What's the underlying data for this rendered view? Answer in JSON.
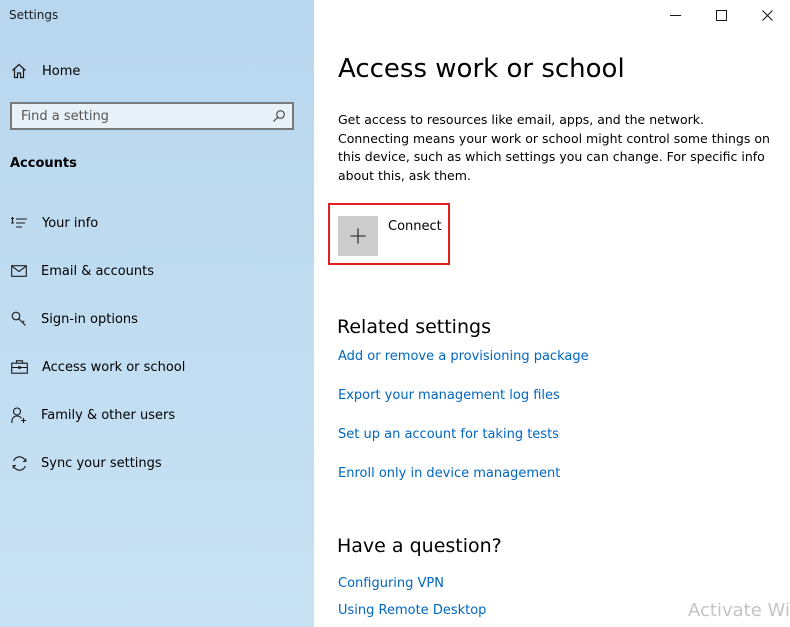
{
  "window": {
    "title": "Settings",
    "controls": [
      "minimize",
      "maximize",
      "close"
    ]
  },
  "sidebar": {
    "home_label": "Home",
    "search_placeholder": "Find a setting",
    "section_title": "Accounts",
    "items": [
      {
        "label": "Your info",
        "icon": "person-card-icon"
      },
      {
        "label": "Email & accounts",
        "icon": "envelope-icon"
      },
      {
        "label": "Sign-in options",
        "icon": "key-icon"
      },
      {
        "label": "Access work or school",
        "icon": "briefcase-icon"
      },
      {
        "label": "Family & other users",
        "icon": "person-add-icon"
      },
      {
        "label": "Sync your settings",
        "icon": "sync-icon"
      }
    ]
  },
  "main": {
    "title": "Access work or school",
    "description": "Get access to resources like email, apps, and the network. Connecting means your work or school might control some things on this device, such as which settings you can change. For specific info about this, ask them.",
    "connect_label": "Connect",
    "related": {
      "heading": "Related settings",
      "links": [
        "Add or remove a provisioning package",
        "Export your management log files",
        "Set up an account for taking tests",
        "Enroll only in device management"
      ]
    },
    "question": {
      "heading": "Have a question?",
      "links": [
        "Configuring VPN",
        "Using Remote Desktop"
      ]
    }
  },
  "overlay": {
    "watermark": "Activate Wi"
  },
  "colors": {
    "link": "#0067c0",
    "highlight_border": "#e02020",
    "sidebar_bg": "#bfdcf1",
    "plus_tile": "#cccccc"
  }
}
